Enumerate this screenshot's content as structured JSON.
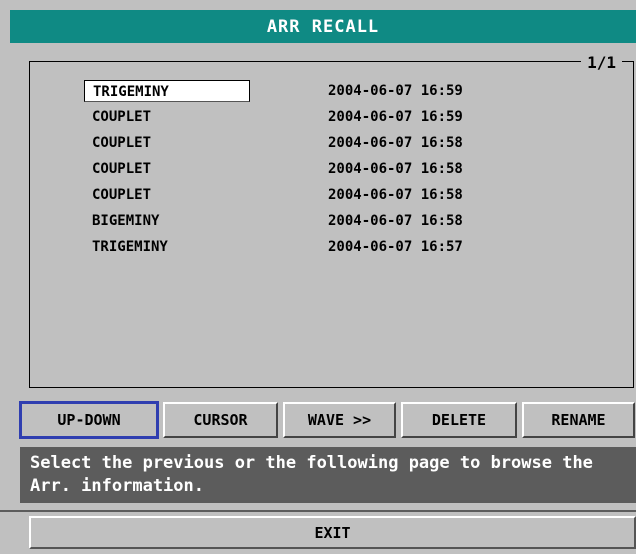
{
  "window": {
    "title": "ARR RECALL"
  },
  "list": {
    "page": "1/1",
    "records": [
      {
        "type": "TRIGEMINY",
        "time": "2004-06-07 16:59",
        "selected": true
      },
      {
        "type": "COUPLET",
        "time": "2004-06-07 16:59"
      },
      {
        "type": "COUPLET",
        "time": "2004-06-07 16:58"
      },
      {
        "type": "COUPLET",
        "time": "2004-06-07 16:58"
      },
      {
        "type": "COUPLET",
        "time": "2004-06-07 16:58"
      },
      {
        "type": "BIGEMINY",
        "time": "2004-06-07 16:58"
      },
      {
        "type": "TRIGEMINY",
        "time": "2004-06-07 16:57"
      }
    ]
  },
  "buttons": {
    "up_down": "UP-DOWN",
    "cursor": "CURSOR",
    "wave": "WAVE >>",
    "delete": "DELETE",
    "rename": "RENAME",
    "focused": "up_down"
  },
  "help": {
    "text": "Select the previous or the following page to browse the Arr. information."
  },
  "exit": {
    "label": "EXIT"
  },
  "colors": {
    "title_bar": "#0f8a84",
    "panel": "#c0c0c0",
    "help_bar": "#5c5c5c",
    "focus_outline": "#2f3eb0"
  }
}
